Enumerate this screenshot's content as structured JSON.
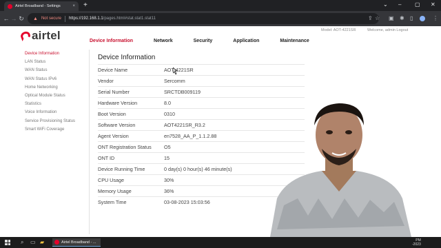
{
  "browser": {
    "tab_title": "Airtel Broadband - Settings",
    "tab_close": "×",
    "new_tab": "+",
    "window_controls": [
      "⌄",
      "–",
      "▢",
      "✕"
    ],
    "security_label": "Not secure",
    "url_host": "https://192.168.1.1",
    "url_path": "/pages.html#stat.stat1.stat11",
    "icons": [
      "back-icon",
      "forward-icon",
      "reload-icon",
      "warning-icon",
      "share-icon",
      "star-icon",
      "extensions-icon",
      "menu-icon"
    ]
  },
  "header": {
    "logo_text": "airtel",
    "model_text": "Model: AOT-4221SR",
    "welcome_text": "Welcome, admin Logout",
    "nav": [
      {
        "label": "Device Information"
      },
      {
        "label": "Network"
      },
      {
        "label": "Security"
      },
      {
        "label": "Application"
      },
      {
        "label": "Maintenance"
      }
    ],
    "active_nav": "Device Information"
  },
  "sidebar": {
    "items": [
      {
        "label": "Device Information"
      },
      {
        "label": "LAN Status"
      },
      {
        "label": "WAN Status"
      },
      {
        "label": "WAN Status IPv6"
      },
      {
        "label": "Home Networking"
      },
      {
        "label": "Optical Module Status"
      },
      {
        "label": "Statistics"
      },
      {
        "label": "Voice Information"
      },
      {
        "label": "Service Provisioning Status"
      },
      {
        "label": "Smart WiFi Coverage"
      }
    ],
    "active_item": "Device Information"
  },
  "main": {
    "title": "Device Information",
    "rows": [
      {
        "key": "Device Name",
        "value": "AOT-4221SR"
      },
      {
        "key": "Vendor",
        "value": "Sercomm"
      },
      {
        "key": "Serial Number",
        "value": "SRCTDB009119"
      },
      {
        "key": "Hardware Version",
        "value": "8.0"
      },
      {
        "key": "Boot Version",
        "value": "0310"
      },
      {
        "key": "Software Version",
        "value": "AOT4221SR_R3.2"
      },
      {
        "key": "Agent Version",
        "value": "en7528_AA_P_1.1.2.88"
      },
      {
        "key": "ONT Registration Status",
        "value": "O5"
      },
      {
        "key": "ONT ID",
        "value": "15"
      },
      {
        "key": "Device Running Time",
        "value": "0 day(s) 0 hour(s) 46 minute(s)"
      },
      {
        "key": "CPU Usage",
        "value": "30%"
      },
      {
        "key": "Memory Usage",
        "value": "36%"
      },
      {
        "key": "System Time",
        "value": "03-08-2023 15:03:56"
      }
    ]
  },
  "taskbar": {
    "app_label": "Airtel Broadband - ...",
    "clock_time": "PM",
    "clock_date": "-2023",
    "icons": [
      "windows-start-icon",
      "search-icon",
      "task-view-icon",
      "file-explorer-icon",
      "chrome-icon"
    ]
  },
  "colors": {
    "brand": "#e4002b",
    "active_nav": "#c8102e"
  }
}
